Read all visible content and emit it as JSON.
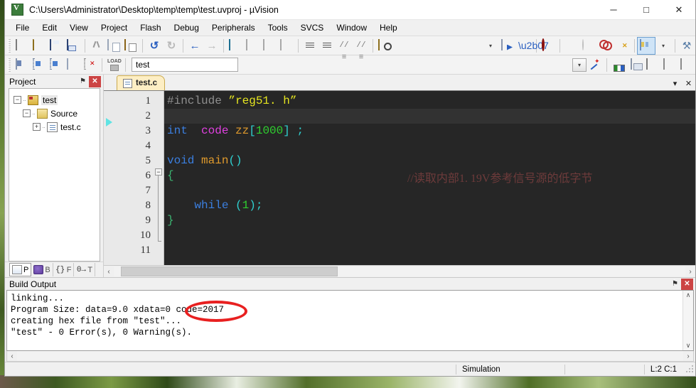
{
  "window": {
    "title": "C:\\Users\\Administrator\\Desktop\\temp\\temp\\test.uvproj - µVision",
    "app_icon": "uvision-logo-icon",
    "controls": {
      "minimize": "─",
      "maximize": "□",
      "close": "✕"
    }
  },
  "menu": {
    "items": [
      {
        "label": "File"
      },
      {
        "label": "Edit"
      },
      {
        "label": "View"
      },
      {
        "label": "Project"
      },
      {
        "label": "Flash"
      },
      {
        "label": "Debug"
      },
      {
        "label": "Peripherals"
      },
      {
        "label": "Tools"
      },
      {
        "label": "SVCS"
      },
      {
        "label": "Window"
      },
      {
        "label": "Help"
      }
    ]
  },
  "toolbar_main": {
    "groups": [
      [
        "new-file",
        "open-file",
        "save",
        "save-all"
      ],
      [
        "cut",
        "copy",
        "paste"
      ],
      [
        "undo",
        "redo"
      ],
      [
        "navigate-back",
        "navigate-forward"
      ],
      [
        "toggle-bookmark",
        "previous-bookmark",
        "next-bookmark",
        "clear-bookmarks"
      ],
      [
        "indent-right",
        "indent-left",
        "comment-selection",
        "uncomment-selection"
      ],
      [
        "find-in-files"
      ]
    ],
    "undo_glyph": "↺",
    "redo_glyph": "↻",
    "back_glyph": "←",
    "forward_glyph": "→",
    "comment_glyph": "//≡",
    "uncomment_glyph": "//≡"
  },
  "toolbar_build": {
    "groups": [
      [
        "build-target",
        "rebuild-all",
        "batch-build",
        "stop-build"
      ],
      [
        "download-to-flash"
      ]
    ],
    "target_select": {
      "value": "test",
      "arrow": "▾"
    },
    "right_group": [
      "manage-project-items",
      "configure-target-options",
      "manage-multi-project-workspace",
      "components-env-books",
      "debug-window",
      "memory-window"
    ],
    "right_caret": "▾"
  },
  "toolbar_debug": {
    "items": [
      "start-debug-session",
      "insert-remove-breakpoint",
      "disable-breakpoint",
      "disable-all-breakpoints",
      "kill-all-breakpoints",
      "project-window-toggle",
      "customize-tools"
    ],
    "dropdown_caret": "▾",
    "wrench_glyph": "⚒"
  },
  "project_panel": {
    "title": "Project",
    "pin_glyph": "⚑",
    "close_glyph": "✕",
    "tree": [
      {
        "label": "test",
        "icon": "project-folder-icon",
        "expander": "−",
        "level": 0,
        "selected": true
      },
      {
        "label": "Source",
        "icon": "source-group-icon",
        "expander": "−",
        "level": 1,
        "selected": false
      },
      {
        "label": "test.c",
        "icon": "c-file-icon",
        "expander": "+",
        "level": 2,
        "selected": false
      }
    ],
    "tabs": [
      {
        "key": "P",
        "label": "P",
        "icon": "project-icon",
        "selected": true
      },
      {
        "key": "B",
        "label": "B",
        "icon": "books-icon",
        "selected": false
      },
      {
        "key": "F",
        "label": "F",
        "icon": "functions-icon",
        "icon_text": "{}",
        "selected": false
      },
      {
        "key": "T",
        "label": "T",
        "icon": "templates-icon",
        "icon_text": "0→",
        "selected": false
      }
    ]
  },
  "editor": {
    "tabs": [
      {
        "label": "test.c",
        "icon": "c-file-icon",
        "active": true
      }
    ],
    "tab_dropdown_glyph": "▾",
    "tab_close_glyph": "✕",
    "line_numbers": [
      "1",
      "2",
      "3",
      "4",
      "5",
      "6",
      "7",
      "8",
      "9",
      "10",
      "11"
    ],
    "current_line": 2,
    "execution_marker_line": 3,
    "fold_marker_line": 6,
    "fold_glyph": "−",
    "lines": [
      {
        "n": 1,
        "tokens": [
          {
            "t": "#include ",
            "c": "pre"
          },
          {
            "t": "”reg51. h”",
            "c": "str"
          }
        ]
      },
      {
        "n": 2,
        "tokens": []
      },
      {
        "n": 3,
        "tokens": [
          {
            "t": "int",
            "c": "kw"
          },
          {
            "t": "  ",
            "c": "plain"
          },
          {
            "t": "code",
            "c": "ckw"
          },
          {
            "t": " ",
            "c": "plain"
          },
          {
            "t": "zz",
            "c": "id"
          },
          {
            "t": "[",
            "c": "br"
          },
          {
            "t": "1000",
            "c": "num"
          },
          {
            "t": "]",
            "c": "br"
          },
          {
            "t": " ;",
            "c": "punct"
          }
        ]
      },
      {
        "n": 4,
        "tokens": []
      },
      {
        "n": 5,
        "tokens": [
          {
            "t": "void",
            "c": "kw"
          },
          {
            "t": " ",
            "c": "plain"
          },
          {
            "t": "main",
            "c": "id"
          },
          {
            "t": "()",
            "c": "br"
          }
        ]
      },
      {
        "n": 6,
        "tokens": [
          {
            "t": "{",
            "c": "brace"
          }
        ]
      },
      {
        "n": 7,
        "tokens": []
      },
      {
        "n": 8,
        "tokens": [
          {
            "t": "    ",
            "c": "plain"
          },
          {
            "t": "while",
            "c": "kw"
          },
          {
            "t": " (",
            "c": "br"
          },
          {
            "t": "1",
            "c": "num"
          },
          {
            "t": ");",
            "c": "br"
          }
        ]
      },
      {
        "n": 9,
        "tokens": [
          {
            "t": "}",
            "c": "brace"
          }
        ]
      },
      {
        "n": 10,
        "tokens": []
      },
      {
        "n": 11,
        "tokens": []
      }
    ],
    "comment": "//读取内部1. 19V参考信号源的低字节",
    "hscroll": {
      "left_glyph": "‹",
      "right_glyph": "›"
    }
  },
  "build_output": {
    "title": "Build Output",
    "pin_glyph": "⚑",
    "close_glyph": "✕",
    "lines": [
      "linking...",
      "Program Size: data=9.0 xdata=0 code=2017",
      "creating hex file from \"test\"...",
      "\"test\" - 0 Error(s), 0 Warning(s)."
    ],
    "annotation": {
      "shape": "red-ellipse",
      "target_text": "code=2017",
      "color": "#e82020"
    },
    "vscroll": {
      "up_glyph": "∧",
      "down_glyph": "∨"
    },
    "hscroll": {
      "left_glyph": "‹",
      "right_glyph": "›"
    }
  },
  "status_bar": {
    "mode": "Simulation",
    "cursor": "L:2 C:1",
    "grip": "resize-grip-icon"
  },
  "colors": {
    "editor_background": "#262626",
    "current_line": "#323232",
    "preprocessor": "#8f8f8f",
    "string": "#e5e520",
    "keyword": "#3b7fe0",
    "code_keyword": "#e040e0",
    "identifier": "#e09a2c",
    "bracket": "#2fd0d0",
    "number": "#2fd02f",
    "brace": "#3cb371",
    "comment": "#6e3b3b",
    "annotation_red": "#e82020",
    "tab_active": "#fdeec4"
  }
}
